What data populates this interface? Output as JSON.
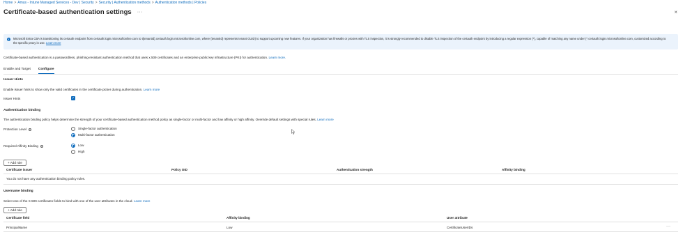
{
  "breadcrumb": [
    "Home",
    "Amus - Intune Managed Services - Dev | Security",
    "Security | Authentication methods",
    "Authentication methods | Policies"
  ],
  "page": {
    "title": "Certificate-based authentication settings",
    "more": "···",
    "close": "×"
  },
  "banner": {
    "text": "Microsoft Entra CBA is transitioning its certauth endpoint from certauth.login.microsoftonline.com to t{tenantId}.certauth.login.microsoftonline.com, where {tenantId} represents tenant GUID) to support upcoming new features. If your organization has firewalls or proxies with TLS inspection, it is strongly recommended to disable TLS inspection of the certauth endpoint by introducing a regular expression (*), capable of matching any name under (*.certauth.login.microsoftonline.com, customized according to the specific proxy in use.",
    "link": "Learn more"
  },
  "description": {
    "text": "Certificate-based authentication is a passwordless, phishing-resistant authentication method that uses x.509 certificates and an enterprise public key infrastructure (PKI) for authentication.",
    "link": "Learn more."
  },
  "tabs": [
    {
      "label": "Enable and Target"
    },
    {
      "label": "Configure"
    }
  ],
  "issuer_hints": {
    "title": "Issuer Hints",
    "desc": "Enable issuer hints to show only the valid certificates in the certificate picker during authentication.",
    "link": "Learn more",
    "checkbox_label": "Issuer Hints"
  },
  "auth_binding": {
    "title": "Authentication binding",
    "desc": "The authentication binding policy helps determine the strength of your certificate-based authentication method policy as single-factor or multi-factor and low affinity or high affinity. Override default settings with special rules.",
    "link": "Learn more",
    "protection_label": "Protection Level",
    "protection_options": [
      "Single-factor authentication",
      "Multi-factor authentication"
    ],
    "affinity_label": "Required Affinity Binding",
    "affinity_options": [
      "Low",
      "High"
    ],
    "add_rule": "+ Add rule",
    "columns": [
      "Certificate issuer",
      "Policy OID",
      "Authentication strength",
      "Affinity binding"
    ],
    "empty": "You do not have any authentication binding policy rules."
  },
  "username_binding": {
    "title": "Username binding",
    "desc": "Select one of the X.509 certificates fields to bind with one of the user attributes in the cloud.",
    "link": "Learn more",
    "add_rule": "+ Add rule",
    "columns": [
      "Certificate field",
      "Affinity binding",
      "User attribute"
    ],
    "rows": [
      {
        "field": "PrincipalName",
        "affinity": "Low",
        "attribute": "CertificateUserIDs"
      }
    ],
    "row_more": "···"
  },
  "colors": {
    "accent": "#0f6cbd",
    "banner_bg": "#ebf3fc"
  }
}
